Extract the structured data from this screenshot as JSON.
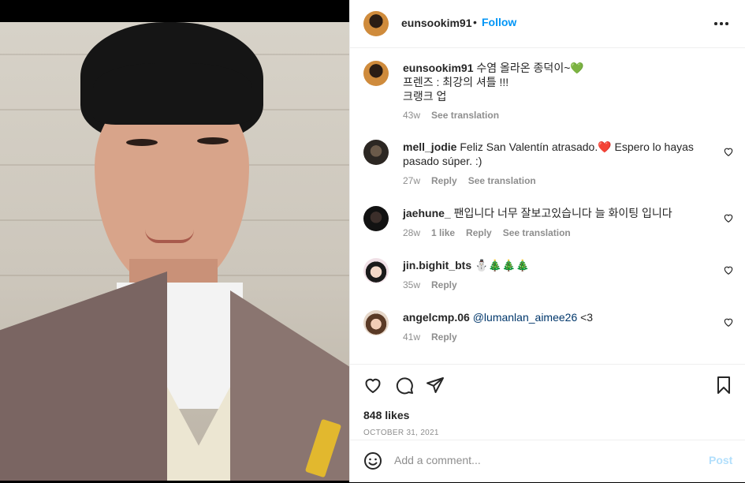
{
  "post_owner": {
    "username": "eunsookim91",
    "separator": "•",
    "follow_label": "Follow"
  },
  "caption": {
    "username": "eunsookim91",
    "lines": [
      "수염 올라온 종덕이~💚",
      "프렌즈 : 최강의 셔틀 !!!",
      "크랭크 업"
    ],
    "time": "43w",
    "see_translation": "See translation"
  },
  "comments": [
    {
      "username": "mell_jodie",
      "text": "Feliz San Valentín atrasado.❤️ Espero lo hayas pasado súper. :)",
      "time": "27w",
      "likes": "",
      "reply": "Reply",
      "see_translation": "See translation"
    },
    {
      "username": "jaehune_",
      "text": "팬입니다 너무 잘보고있습니다 늘 화이팅 입니다",
      "time": "28w",
      "likes": "1 like",
      "reply": "Reply",
      "see_translation": "See translation"
    },
    {
      "username": "jin.bighit_bts",
      "text": "⛄🎄🎄🎄",
      "time": "35w",
      "likes": "",
      "reply": "Reply",
      "see_translation": ""
    },
    {
      "username": "angelcmp.06",
      "mention": "@lumanlan_aimee26",
      "text": "<3",
      "time": "41w",
      "likes": "",
      "reply": "Reply",
      "see_translation": ""
    }
  ],
  "likes": "848 likes",
  "date": "OCTOBER 31, 2021",
  "add_comment_placeholder": "Add a comment...",
  "post_label": "Post",
  "colors": {
    "accent": "#0095f6",
    "text": "#262626",
    "muted": "#8e8e8e"
  },
  "icons": [
    "more-icon",
    "heart-icon",
    "comment-icon",
    "share-icon",
    "bookmark-icon",
    "emoji-icon"
  ]
}
